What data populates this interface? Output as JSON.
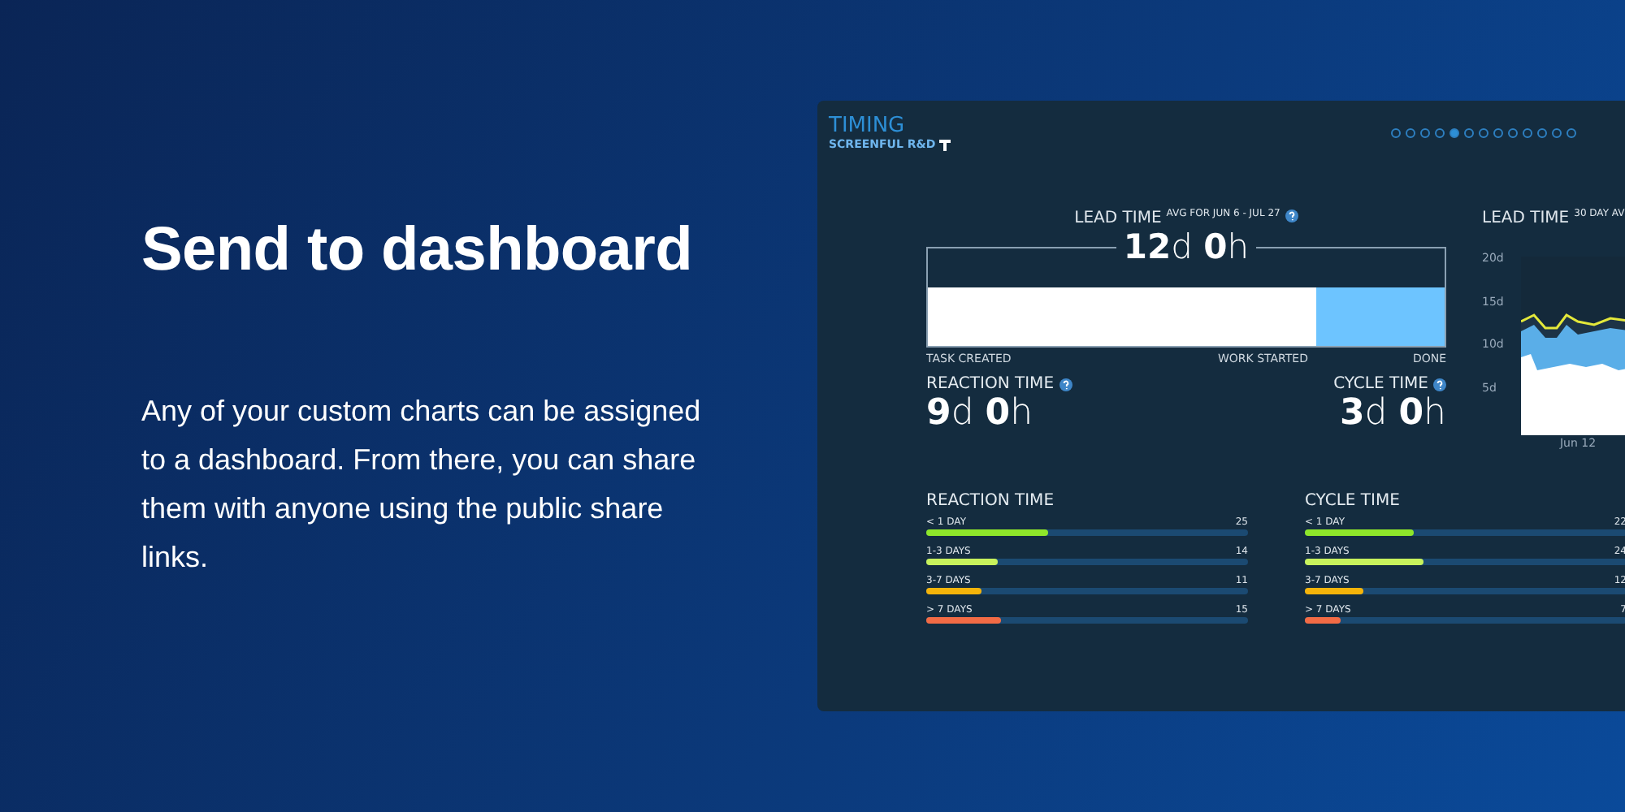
{
  "heading": "Send to dashboard",
  "body": "Any of your custom charts can be assigned to a dashboard. From there, you can share them with anyone using the public share links.",
  "dashboard": {
    "title": "TIMING",
    "subtitle": "SCREENFUL R&D",
    "pages": [
      {
        "selected": false
      },
      {
        "selected": false
      },
      {
        "selected": false
      },
      {
        "selected": false
      },
      {
        "selected": true
      },
      {
        "selected": false
      },
      {
        "selected": false
      },
      {
        "selected": false
      },
      {
        "selected": false
      },
      {
        "selected": false
      },
      {
        "selected": false
      },
      {
        "selected": false
      },
      {
        "selected": false
      }
    ],
    "lead_time": {
      "label": "LEAD TIME",
      "note": "AVG FOR JUN 6 - JUL 27",
      "value": "**12**d **0**h",
      "level": 0.75,
      "start_label": "TASK CREATED",
      "mid_label": "WORK STARTED",
      "end_label": "DONE"
    },
    "reaction_time": {
      "label": "REACTION TIME",
      "value": "**9**d **0**h"
    },
    "cycle_time": {
      "label": "CYCLE TIME",
      "value": "**3**d **0**h"
    },
    "trend": {
      "label": "LEAD TIME",
      "note": "30 DAY AV",
      "y_ticks": [
        "20d",
        "15d",
        "10d",
        "5d"
      ],
      "x_label": "Jun 12"
    },
    "breakdowns": [
      {
        "title": "REACTION TIME",
        "rows": [
          {
            "label": "< 1 DAY",
            "value": "25",
            "level": 0.38,
            "color": "#8ee62a"
          },
          {
            "label": "1-3 DAYS",
            "value": "14",
            "level": 0.22,
            "color": "#c8f25c"
          },
          {
            "label": "3-7 DAYS",
            "value": "11",
            "level": 0.17,
            "color": "#f5b40a"
          },
          {
            "label": "> 7 DAYS",
            "value": "15",
            "level": 0.23,
            "color": "#f26b45"
          }
        ]
      },
      {
        "title": "CYCLE TIME",
        "rows": [
          {
            "label": "< 1 DAY",
            "value": "22",
            "level": 0.34,
            "color": "#8ee62a"
          },
          {
            "label": "1-3 DAYS",
            "value": "24",
            "level": 0.37,
            "color": "#c8f25c"
          },
          {
            "label": "3-7 DAYS",
            "value": "12",
            "level": 0.18,
            "color": "#f5b40a"
          },
          {
            "label": "> 7 DAYS",
            "value": "7",
            "level": 0.11,
            "color": "#f26b45"
          }
        ]
      }
    ]
  }
}
